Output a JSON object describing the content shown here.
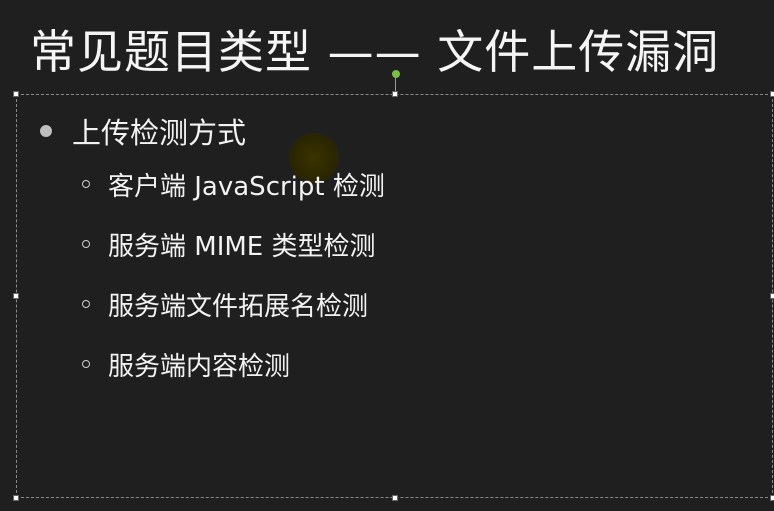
{
  "slide": {
    "title": "常见题目类型 —— 文件上传漏洞",
    "bullet": {
      "label": "上传检测方式",
      "sub_items": [
        {
          "label": "客户端 JavaScript 检测"
        },
        {
          "label": "服务端 MIME 类型检测"
        },
        {
          "label": "服务端文件拓展名检测"
        },
        {
          "label": "服务端内容检测"
        }
      ]
    }
  },
  "colors": {
    "background": "#1f1f1f",
    "text": "#f2f2f2",
    "rotate_handle": "#7ac143"
  }
}
